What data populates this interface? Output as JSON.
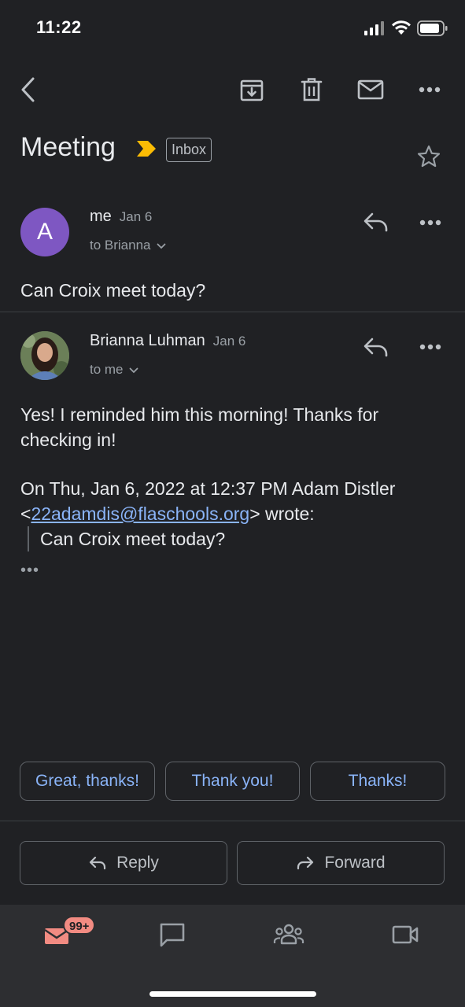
{
  "status_bar": {
    "time": "11:22"
  },
  "toolbar": {
    "back": "back-arrow-icon",
    "archive": "archive-icon",
    "delete": "trash-icon",
    "mark_unread": "mail-icon",
    "more": "more-horizontal-icon"
  },
  "thread": {
    "subject": "Meeting",
    "label": "Inbox"
  },
  "messages": [
    {
      "avatar_letter": "A",
      "sender": "me",
      "date": "Jan 6",
      "recipients": "to Brianna",
      "body": "Can Croix meet today?"
    },
    {
      "sender": "Brianna Luhman",
      "date": "Jan 6",
      "recipients": "to me",
      "body_line1": "Yes! I reminded him this morning! Thanks for",
      "body_line2": "checking in!",
      "quote_header_1": "On Thu, Jan 6, 2022 at 12:37 PM Adam Distler",
      "quote_open": "<",
      "quote_email": "22adamdis@flaschools.org",
      "quote_close": "> wrote:",
      "quoted_text": "Can Croix meet today?",
      "trimmed": "•••"
    }
  ],
  "smart_replies": [
    "Great, thanks!",
    "Thank you!",
    "Thanks!"
  ],
  "actions": {
    "reply": "Reply",
    "forward": "Forward"
  },
  "bottom_nav": {
    "mail_badge": "99+"
  },
  "colors": {
    "accent": "#8ab4f8",
    "avatar": "#7e57c2",
    "important": "#fbbc04",
    "badge": "#f28b82"
  }
}
